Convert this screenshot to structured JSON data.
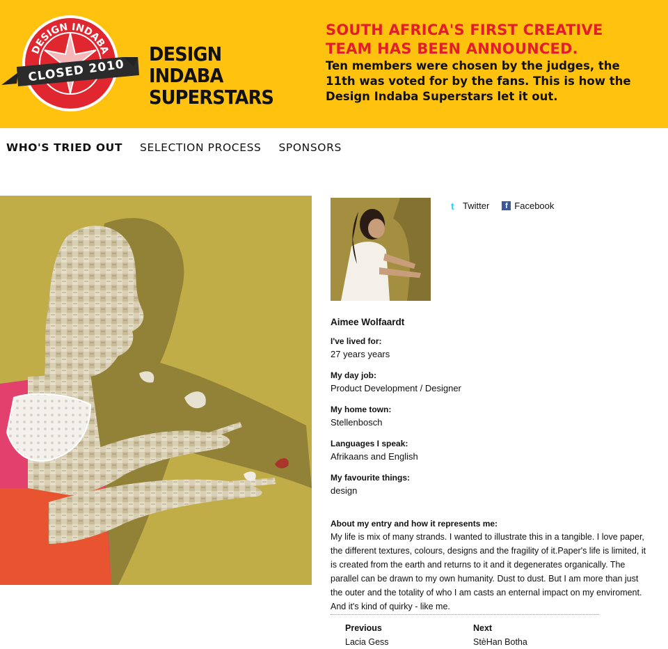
{
  "header": {
    "seal_top_text": "DESIGN INDABA",
    "ribbon_text": "CLOSED 2010",
    "brand_line1": "DESIGN INDABA",
    "brand_line2": "SUPERSTARS",
    "headline": "SOUTH AFRICA'S FIRST CREATIVE TEAM HAS BEEN ANNOUNCED.",
    "subline": "Ten members were chosen by the judges, the 11th was voted for by the fans. This is how the Design Indaba Superstars let it out.",
    "colors": {
      "background": "#ffc20e",
      "headline": "#e31d2b",
      "seal": "#e0262e"
    }
  },
  "nav": {
    "items": [
      {
        "label": "WHO'S TRIED OUT"
      },
      {
        "label": "SELECTION PROCESS"
      },
      {
        "label": "SPONSORS"
      }
    ]
  },
  "share": {
    "twitter": "Twitter",
    "facebook": "Facebook"
  },
  "profile": {
    "name": "Aimee Wolfaardt",
    "facts": [
      {
        "label": "I've lived for:",
        "value": "27 years years"
      },
      {
        "label": "My day job:",
        "value": "Product Development / Designer"
      },
      {
        "label": "My home town:",
        "value": "Stellenbosch"
      },
      {
        "label": "Languages I speak:",
        "value": "Afrikaans and English"
      },
      {
        "label": "My favourite things:",
        "value": "design"
      }
    ],
    "about_label": "About my entry and how it represents me:",
    "about_text": "My life is mix of many strands. I wanted to illustrate this in a tangible. I love paper, the different textures, colours, designs and the fragility of it.Paper's life is limited, it is created from the earth and returns to it and it degenerates organically. The parallel can be drawn to my own humanity. Dust to dust. But I am more than just the outer and the totality of who I am casts an enternal impact on my enviroment. And it's kind of quirky - like me."
  },
  "pager": {
    "previous_label": "Previous",
    "previous_name": "Lacia Gess",
    "next_label": "Next",
    "next_name": "StèHan Botha"
  }
}
